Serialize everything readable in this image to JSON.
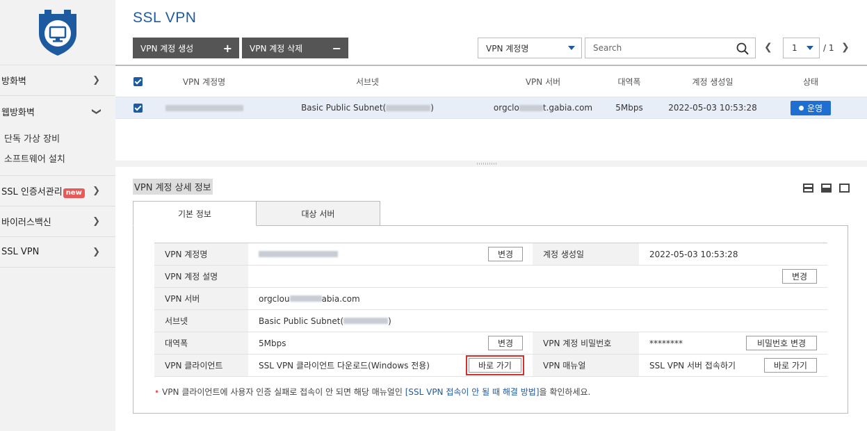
{
  "sidebar": {
    "items": [
      {
        "label": "방화벽"
      },
      {
        "label": "웹방화벽",
        "sub": [
          "단독 가상 장비",
          "소프트웨어 설치"
        ]
      },
      {
        "label": "SSL 인증서관리",
        "badge": "new"
      },
      {
        "label": "바이러스백신"
      },
      {
        "label": "SSL VPN"
      }
    ]
  },
  "header": {
    "title": "SSL VPN",
    "create_label": "VPN 계정 생성",
    "delete_label": "VPN 계정 삭제",
    "filter_value": "VPN 계정명",
    "search_placeholder": "Search",
    "page_current": "1",
    "page_total": "/ 1"
  },
  "table": {
    "columns": [
      "VPN 계정명",
      "서브넷",
      "VPN 서버",
      "대역폭",
      "계정 생성일",
      "상태"
    ],
    "rows": [
      {
        "subnet_prefix": "Basic Public Subnet(",
        "subnet_suffix": ")",
        "server_prefix": "orgclo",
        "server_suffix": "t.gabia.com",
        "bandwidth": "5Mbps",
        "created": "2022-05-03 10:53:28",
        "status": "운영"
      }
    ]
  },
  "detail": {
    "title": "VPN 계정 상세 정보",
    "tabs": [
      "기본 정보",
      "대상 서버"
    ],
    "labels": {
      "account_name": "VPN 계정명",
      "created": "계정 생성일",
      "description": "VPN 계정 설명",
      "server": "VPN 서버",
      "subnet": "서브넷",
      "bandwidth": "대역폭",
      "password": "VPN 계정 비밀번호",
      "client": "VPN 클라이언트",
      "manual": "VPN 매뉴얼"
    },
    "values": {
      "created": "2022-05-03 10:53:28",
      "server_prefix": "orgclou",
      "server_suffix": "abia.com",
      "subnet_prefix": "Basic Public Subnet(",
      "subnet_suffix": ")",
      "bandwidth": "5Mbps",
      "password": "********",
      "client": "SSL VPN 클라이언트 다운로드(Windows 전용)",
      "manual": "SSL VPN 서버 접속하기"
    },
    "buttons": {
      "change": "변경",
      "change_password": "비밀번호 변경",
      "go": "바로 가기"
    },
    "note_prefix": "VPN 클라이언트에 사용자 인증 실패로 접속이 안 되면 해당 매뉴얼인 ",
    "note_link": "[SSL VPN 접속이 안 될 때 해결 방법]",
    "note_suffix": "을 확인하세요."
  },
  "colors": {
    "accent": "#1e5aa0",
    "badge": "#1e6fd0",
    "new_badge": "#e85a5a"
  }
}
